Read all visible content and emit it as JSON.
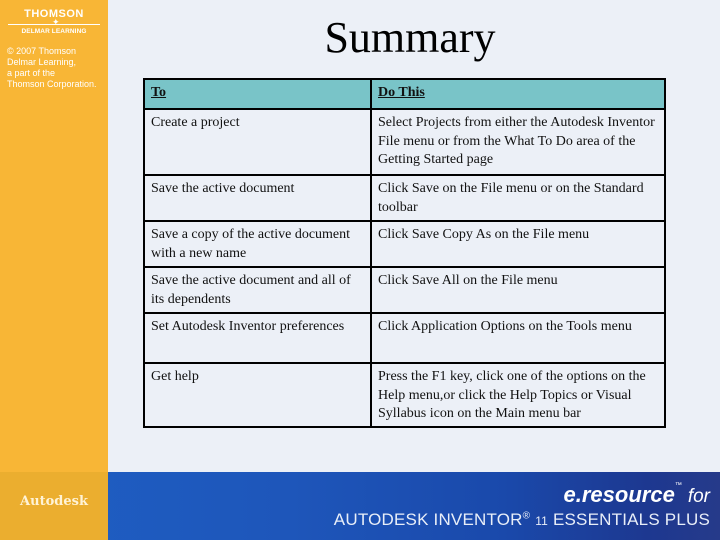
{
  "sidebar": {
    "brand_top": "THOMSON",
    "brand_sub": "DELMAR LEARNING",
    "copyright": "© 2007 Thomson\nDelmar Learning,\na part of the\nThomson Corporation."
  },
  "title": "Summary",
  "table": {
    "headers": [
      "To",
      "Do This"
    ],
    "rows": [
      [
        "Create a project",
        "Select Projects from either the Autodesk Inventor File menu or from the What To Do area of the Getting Started page"
      ],
      [
        "Save the active document",
        "Click Save on the File menu or on the Standard toolbar"
      ],
      [
        "Save a copy of the active document with a new name",
        "Click Save Copy As on the File menu"
      ],
      [
        "Save the active document and all of its dependents",
        "Click Save All on the File menu"
      ],
      [
        "Set Autodesk Inventor preferences",
        "Click Application Options on the Tools menu"
      ],
      [
        "Get help",
        "Press the F1 key, click one of the options on the Help menu,or click the Help Topics or Visual Syllabus icon on the Main menu bar"
      ]
    ]
  },
  "footer": {
    "autodesk": "Autodesk",
    "eresource": "e.resource",
    "tm": "™",
    "for": "for",
    "product_a": "AUTODESK INVENTOR",
    "product_reg": "®",
    "product_num": "11",
    "product_b": "ESSENTIALS PLUS"
  },
  "colors": {
    "sidebar": "#F8B636",
    "background": "#ECF0F7",
    "table_header": "#79C4C8",
    "footer_blue": "#1E56BA"
  }
}
